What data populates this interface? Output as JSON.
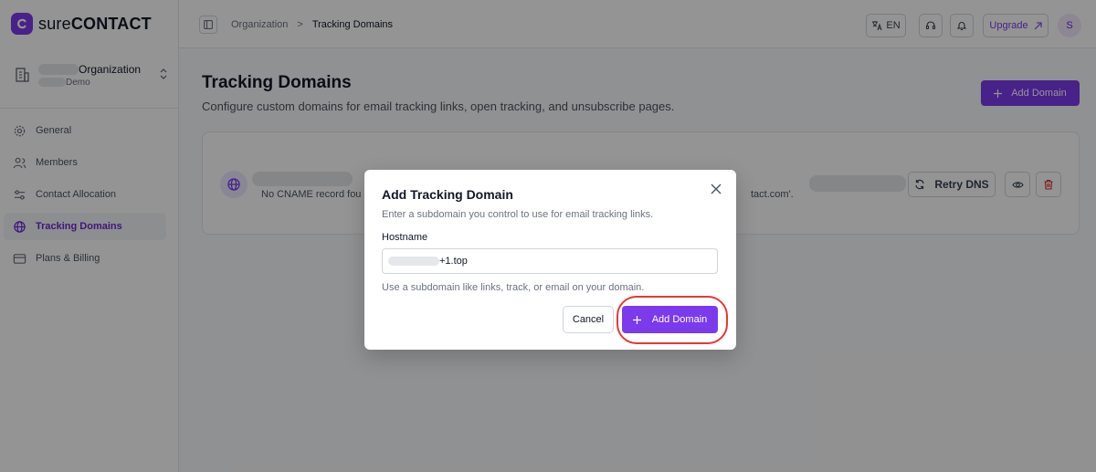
{
  "app": {
    "brand_light": "sure",
    "brand_bold": "CONTACT",
    "accent": "#7c3aed"
  },
  "org": {
    "name_suffix": "Organization",
    "sub_suffix": "Demo"
  },
  "sidebar": {
    "items": [
      {
        "label": "General",
        "icon": "gear-icon",
        "active": false
      },
      {
        "label": "Members",
        "icon": "users-icon",
        "active": false
      },
      {
        "label": "Contact Allocation",
        "icon": "sliders-icon",
        "active": false
      },
      {
        "label": "Tracking Domains",
        "icon": "globe-icon",
        "active": true
      },
      {
        "label": "Plans & Billing",
        "icon": "card-icon",
        "active": false
      }
    ]
  },
  "topbar": {
    "breadcrumb": [
      "Organization",
      "Tracking Domains"
    ],
    "breadcrumb_sep": ">",
    "language": "EN",
    "upgrade_label": "Upgrade",
    "avatar_initial": "S"
  },
  "page": {
    "title": "Tracking Domains",
    "subtitle": "Configure custom domains for email tracking links, open tracking, and unsubscribe pages.",
    "add_button": "Add Domain"
  },
  "domain_row": {
    "error_text": "No CNAME record fou",
    "error_tail": "tact.com'.",
    "retry_label": "Retry DNS"
  },
  "modal": {
    "title": "Add Tracking Domain",
    "description": "Enter a subdomain you control to use for email tracking links.",
    "field_label": "Hostname",
    "field_value": "+1.top",
    "hint": "Use a subdomain like links, track, or email on your domain.",
    "cancel_label": "Cancel",
    "submit_label": "Add Domain"
  }
}
